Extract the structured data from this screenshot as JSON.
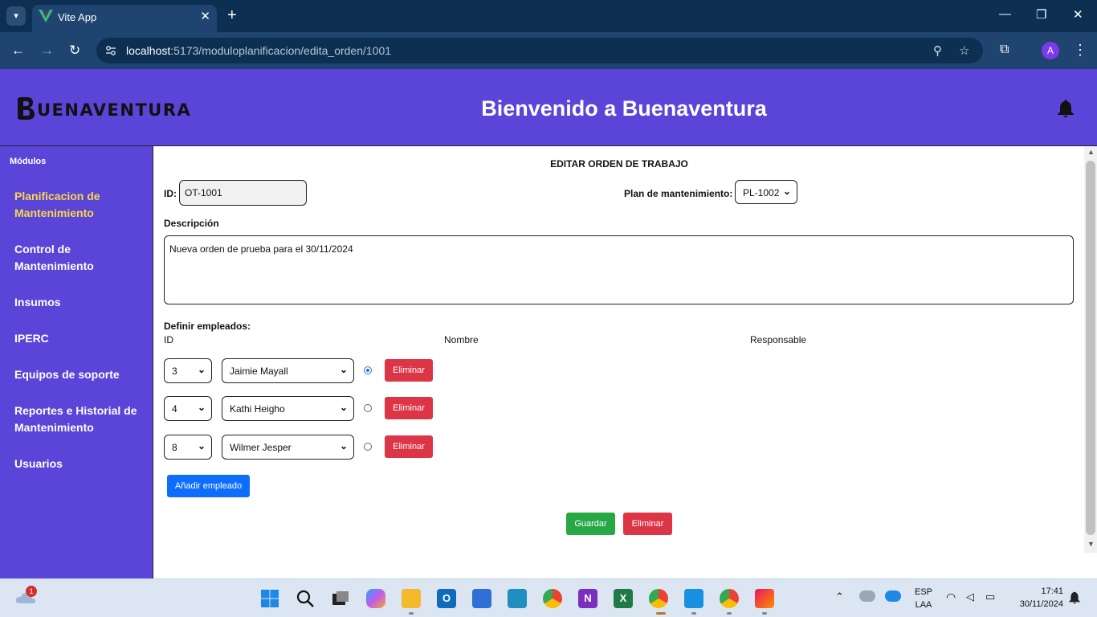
{
  "browser": {
    "tab_title": "Vite App",
    "url_host": "localhost",
    "url_rest": ":5173/moduloplanificacion/edita_orden/1001"
  },
  "header": {
    "logo_text": "UENAVENTURA",
    "title": "Bienvenido a Buenaventura"
  },
  "sidebar": {
    "heading": "Módulos",
    "items": [
      {
        "label": "Planificacion de Mantenimiento",
        "active": true
      },
      {
        "label": "Control de Mantenimiento"
      },
      {
        "label": "Insumos"
      },
      {
        "label": "IPERC"
      },
      {
        "label": "Equipos de soporte"
      },
      {
        "label": "Reportes e Historial de Mantenimiento"
      },
      {
        "label": "Usuarios"
      }
    ]
  },
  "form": {
    "title": "EDITAR ORDEN DE TRABAJO",
    "id_label": "ID:",
    "id_value": "OT-1001",
    "plan_label": "Plan de mantenimiento:",
    "plan_value": "PL-1002",
    "desc_label": "Descripción",
    "desc_value": "Nueva orden de prueba para el 30/11/2024",
    "employees_label": "Definir empleados:",
    "col_id": "ID",
    "col_name": "Nombre",
    "col_resp": "Responsable",
    "employees": [
      {
        "id": "3",
        "name": "Jaimie Mayall",
        "responsible": true,
        "delete": "Eliminar"
      },
      {
        "id": "4",
        "name": "Kathi Heigho",
        "responsible": false,
        "delete": "Eliminar"
      },
      {
        "id": "8",
        "name": "Wilmer Jesper",
        "responsible": false,
        "delete": "Eliminar"
      }
    ],
    "add_employee": "Añadir empleado",
    "save": "Guardar",
    "delete": "Eliminar"
  },
  "taskbar": {
    "weather_badge": "1",
    "lang_top": "ESP",
    "lang_bottom": "LAA",
    "time": "17:41",
    "date": "30/11/2024"
  },
  "colors": {
    "brand": "#5b45d8",
    "active_menu": "#f7d84a",
    "danger": "#dc3545",
    "success": "#28a745",
    "primary": "#0d6efd"
  }
}
